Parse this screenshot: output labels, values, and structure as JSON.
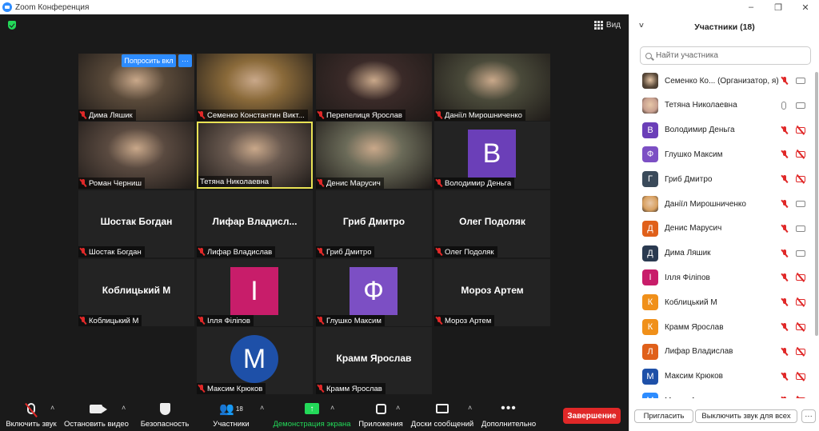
{
  "window": {
    "title": "Zoom Конференция",
    "controls": [
      "–",
      "❐",
      "✕"
    ]
  },
  "view_button": "Вид",
  "ask_unmute": {
    "label": "Попросить вкл",
    "more": "···"
  },
  "tiles": [
    {
      "name": "Дима Ляшик",
      "kind": "camera",
      "muted": true,
      "color": "#5a4a3a"
    },
    {
      "name": "Семенко Константин Викт...",
      "kind": "camera",
      "muted": true,
      "color": "#8a6a3a"
    },
    {
      "name": "Перепелиця Ярослав",
      "kind": "camera",
      "muted": true,
      "color": "#3a2a28"
    },
    {
      "name": "Даніїл Мирошниченко",
      "kind": "camera",
      "muted": true,
      "color": "#4a4a3a"
    },
    {
      "name": "Роман Черниш",
      "kind": "camera",
      "muted": true,
      "color": "#5a4a40"
    },
    {
      "name": "Тетяна Николаевна",
      "kind": "camera",
      "muted": false,
      "active": true,
      "color": "#6a5a50"
    },
    {
      "name": "Денис Марусич",
      "kind": "camera",
      "muted": true,
      "color": "#6a6a58"
    },
    {
      "name": "Володимир Деньга",
      "kind": "avatar",
      "letter": "В",
      "muted": true,
      "color": "#6b3fb8"
    },
    {
      "name": "Шостак Богдан",
      "kind": "text",
      "big": "Шостак Богдан",
      "muted": true
    },
    {
      "name": "Лифар Владислав",
      "kind": "text",
      "big": "Лифар  Владисл...",
      "muted": true
    },
    {
      "name": "Гриб Дмитро",
      "kind": "text",
      "big": "Гриб Дмитро",
      "muted": true
    },
    {
      "name": "Олег Подоляк",
      "kind": "text",
      "big": "Олег Подоляк",
      "muted": true
    },
    {
      "name": "Коблицький М",
      "kind": "text",
      "big": "Коблицький М",
      "muted": true
    },
    {
      "name": "Ілля Філіпов",
      "kind": "avatar",
      "letter": "І",
      "muted": true,
      "color": "#c81d6a"
    },
    {
      "name": "Глушко Максим",
      "kind": "avatar",
      "letter": "Ф",
      "muted": true,
      "color": "#7c4fc4"
    },
    {
      "name": "Мороз Артем",
      "kind": "text",
      "big": "Мороз Артем",
      "muted": true
    },
    {
      "name": "Максим Крюков",
      "kind": "avatar-round",
      "letter": "M",
      "muted": true,
      "color": "#1e50a8"
    },
    {
      "name": "Крамм Ярослав",
      "kind": "text",
      "big": "Крамм Ярослав",
      "muted": true
    }
  ],
  "toolbar": {
    "mute": "Включить звук",
    "video": "Остановить видео",
    "security": "Безопасность",
    "participants": "Участники",
    "participants_count": "18",
    "share": "Демонстрация экрана",
    "apps": "Приложения",
    "whiteboards": "Доски сообщений",
    "more": "Дополнительно",
    "end": "Завершение"
  },
  "panel": {
    "title": "Участники (18)",
    "search_placeholder": "Найти участника",
    "invite": "Пригласить",
    "mute_all": "Выключить звук для всех",
    "more": "···",
    "participants": [
      {
        "name": "Семенко Ко...  (Организатор, я)",
        "avatar": "photo",
        "color": "#5a4a3a",
        "mic": "off",
        "cam": "on"
      },
      {
        "name": "Тетяна Николаевна",
        "avatar": "photo",
        "color": "#c8a090",
        "mic": "on",
        "cam": "on"
      },
      {
        "name": "Володимир Деньга",
        "avatar": "В",
        "color": "#6b3fb8",
        "mic": "off",
        "cam": "off"
      },
      {
        "name": "Глушко Максим",
        "avatar": "Ф",
        "color": "#7c4fc4",
        "mic": "off",
        "cam": "off"
      },
      {
        "name": "Гриб Дмитро",
        "avatar": "Г",
        "color": "#3a4a5a",
        "mic": "off",
        "cam": "off"
      },
      {
        "name": "Даніїл Мирошниченко",
        "avatar": "photo",
        "color": "#d8a060",
        "mic": "off",
        "cam": "on"
      },
      {
        "name": "Денис Марусич",
        "avatar": "Д",
        "color": "#e0601a",
        "mic": "off",
        "cam": "on"
      },
      {
        "name": "Дима Ляшик",
        "avatar": "Д",
        "color": "#2a3a50",
        "mic": "off",
        "cam": "on"
      },
      {
        "name": "Ілля Філіпов",
        "avatar": "І",
        "color": "#c81d6a",
        "mic": "off",
        "cam": "off"
      },
      {
        "name": "Коблицький М",
        "avatar": "К",
        "color": "#f0901a",
        "mic": "off",
        "cam": "off"
      },
      {
        "name": "Крамм Ярослав",
        "avatar": "К",
        "color": "#f0901a",
        "mic": "off",
        "cam": "off"
      },
      {
        "name": "Лифар Владислав",
        "avatar": "Л",
        "color": "#e0601a",
        "mic": "off",
        "cam": "off"
      },
      {
        "name": "Максим Крюков",
        "avatar": "M",
        "color": "#1e50a8",
        "mic": "off",
        "cam": "off"
      },
      {
        "name": "Мороз Артем",
        "avatar": "M",
        "color": "#2d8cff",
        "mic": "off",
        "cam": "off"
      }
    ]
  }
}
